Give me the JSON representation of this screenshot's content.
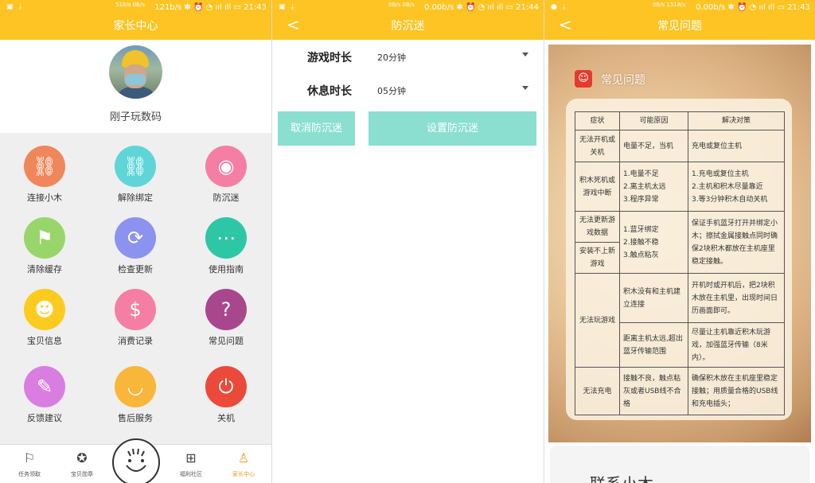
{
  "status_bars": [
    {
      "net": "518/s\n0B/s",
      "speed": "121b/s",
      "time": "21:43"
    },
    {
      "net": "0B/s\n0B/s",
      "speed": "0.00b/s",
      "time": "21:44"
    },
    {
      "net": "0B/s\n1518/s",
      "speed": "0.00b/s",
      "time": "21:43"
    }
  ],
  "parent_center": {
    "title": "家长中心",
    "profile_name": "刚子玩数码",
    "grid": [
      {
        "label": "连接小木",
        "icon": "link-icon",
        "color": "#f0875a"
      },
      {
        "label": "解除绑定",
        "icon": "unlink-icon",
        "color": "#5fd5d8"
      },
      {
        "label": "防沉迷",
        "icon": "eye-icon",
        "color": "#f57ea5"
      },
      {
        "label": "清除缓存",
        "icon": "broom-icon",
        "color": "#98d66b"
      },
      {
        "label": "检查更新",
        "icon": "refresh-icon",
        "color": "#8b93ee"
      },
      {
        "label": "使用指南",
        "icon": "chat-icon",
        "color": "#2ec7a5"
      },
      {
        "label": "宝贝信息",
        "icon": "baby-icon",
        "color": "#fdcb1f"
      },
      {
        "label": "消费记录",
        "icon": "dollar-icon",
        "color": "#f57ea5"
      },
      {
        "label": "常见问题",
        "icon": "question-icon",
        "color": "#a9478e"
      },
      {
        "label": "反馈建议",
        "icon": "edit-icon",
        "color": "#d97ee0"
      },
      {
        "label": "售后服务",
        "icon": "smile-icon",
        "color": "#f8b73a"
      },
      {
        "label": "关机",
        "icon": "power-icon",
        "color": "#eb4a3a"
      }
    ],
    "tabs": [
      {
        "label": "任务领取",
        "icon": "flag-icon"
      },
      {
        "label": "宝贝勋章",
        "icon": "medal-icon"
      },
      {
        "label": "福利社区",
        "icon": "gift-icon"
      },
      {
        "label": "家长中心",
        "icon": "user-icon"
      }
    ]
  },
  "anti_addiction": {
    "title": "防沉迷",
    "game_label": "游戏时长",
    "game_value": "20分钟",
    "rest_label": "休息时长",
    "rest_value": "05分钟",
    "cancel_label": "取消防沉迷",
    "set_label": "设置防沉迷"
  },
  "faq": {
    "title": "常见问题",
    "card_title": "常见问题",
    "headers": [
      "症状",
      "可能原因",
      "解决对策"
    ],
    "rows": [
      {
        "symptom": "无法开机或关机",
        "cause": "电量不足，当机",
        "fix": "充电或复位主机"
      },
      {
        "symptom": "积木死机或游戏中断",
        "cause": "1.电量不足\n2.离主机太远\n3.程序异常",
        "fix": "1.充电或复位主机\n2.主机和积木尽量靠近\n3.等3分钟积木自动关机"
      },
      {
        "symptom": "无法更新游戏数据",
        "cause": "1.蓝牙绑定\n2.接触不稳\n3.触点粘灰",
        "fix": "保证手机蓝牙打开并绑定小木；擦拭金属接触点同时确保2块积木都放在主机座里稳定接触。"
      },
      {
        "symptom": "安装不上新游戏",
        "cause": "",
        "fix": ""
      },
      {
        "symptom": "无法玩游戏",
        "cause": "积木没有和主机建立连接",
        "fix": "开机时或开机后，把2块积木放在主机里，出现时间日历画面即可。"
      },
      {
        "symptom": "",
        "cause": "距离主机太远,超出蓝牙传输范围",
        "fix": "尽量让主机靠近积木玩游戏，加强蓝牙传输（8米内）。"
      },
      {
        "symptom": "无法充电",
        "cause": "接触不良，触点粘灰或者USB线不合格",
        "fix": "确保积木放在主机座里稳定接触；用质量合格的USB线和充电插头；"
      }
    ],
    "contact": "联系小木"
  }
}
